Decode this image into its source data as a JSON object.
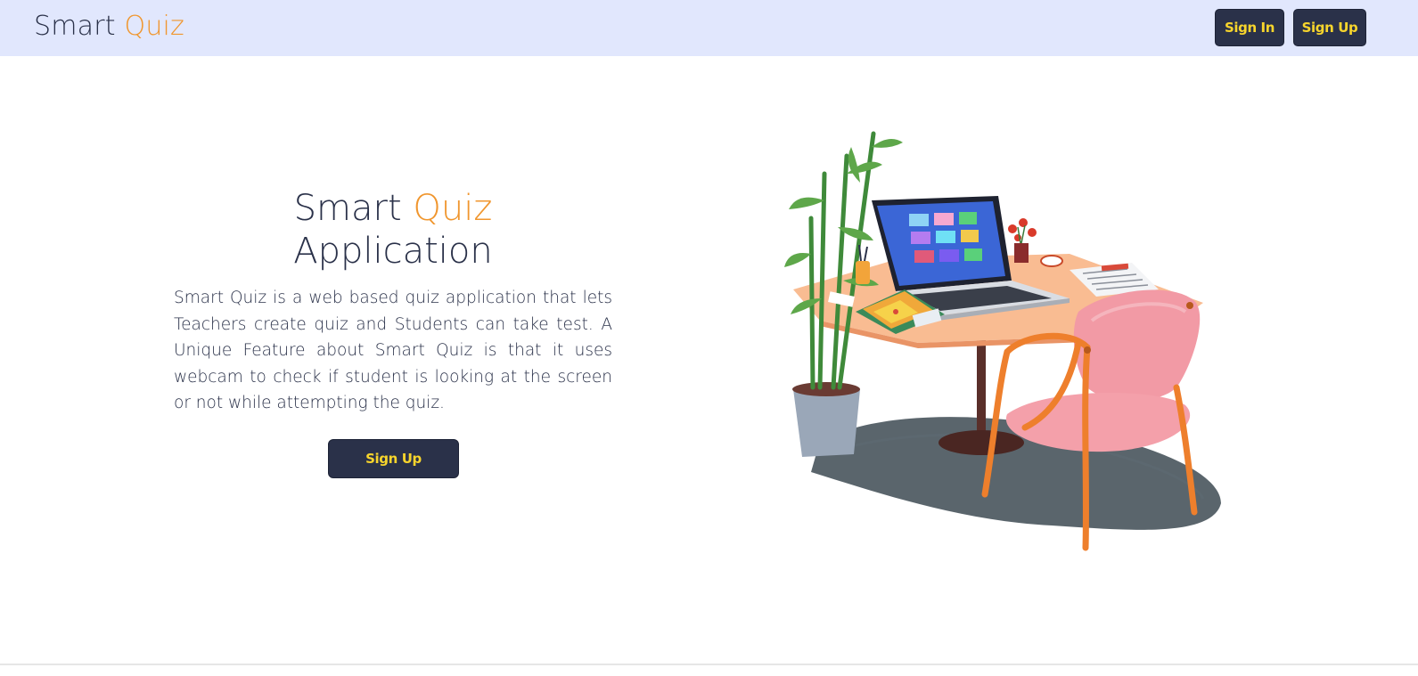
{
  "brand": {
    "name": "Smart",
    "accent": "Quiz"
  },
  "nav": {
    "signin_label": "Sign In",
    "signup_label": "Sign Up"
  },
  "hero": {
    "title_part1": "Smart",
    "title_accent": "Quiz",
    "title_part2": "Application",
    "description": "Smart Quiz is a web based quiz application that lets Teachers create quiz and Students can take test. A Unique Feature about Smart Quiz is that it uses webcam to check if student is looking at the screen or not while attempting the quiz.",
    "cta_label": "Sign Up"
  },
  "colors": {
    "navbar_bg": "#e1e7fd",
    "primary_dark": "#2a3149",
    "accent_orange": "#f0962e",
    "button_text_yellow": "#f8d52c"
  },
  "illustration": {
    "icon": "desk-laptop-chair-illustration"
  }
}
